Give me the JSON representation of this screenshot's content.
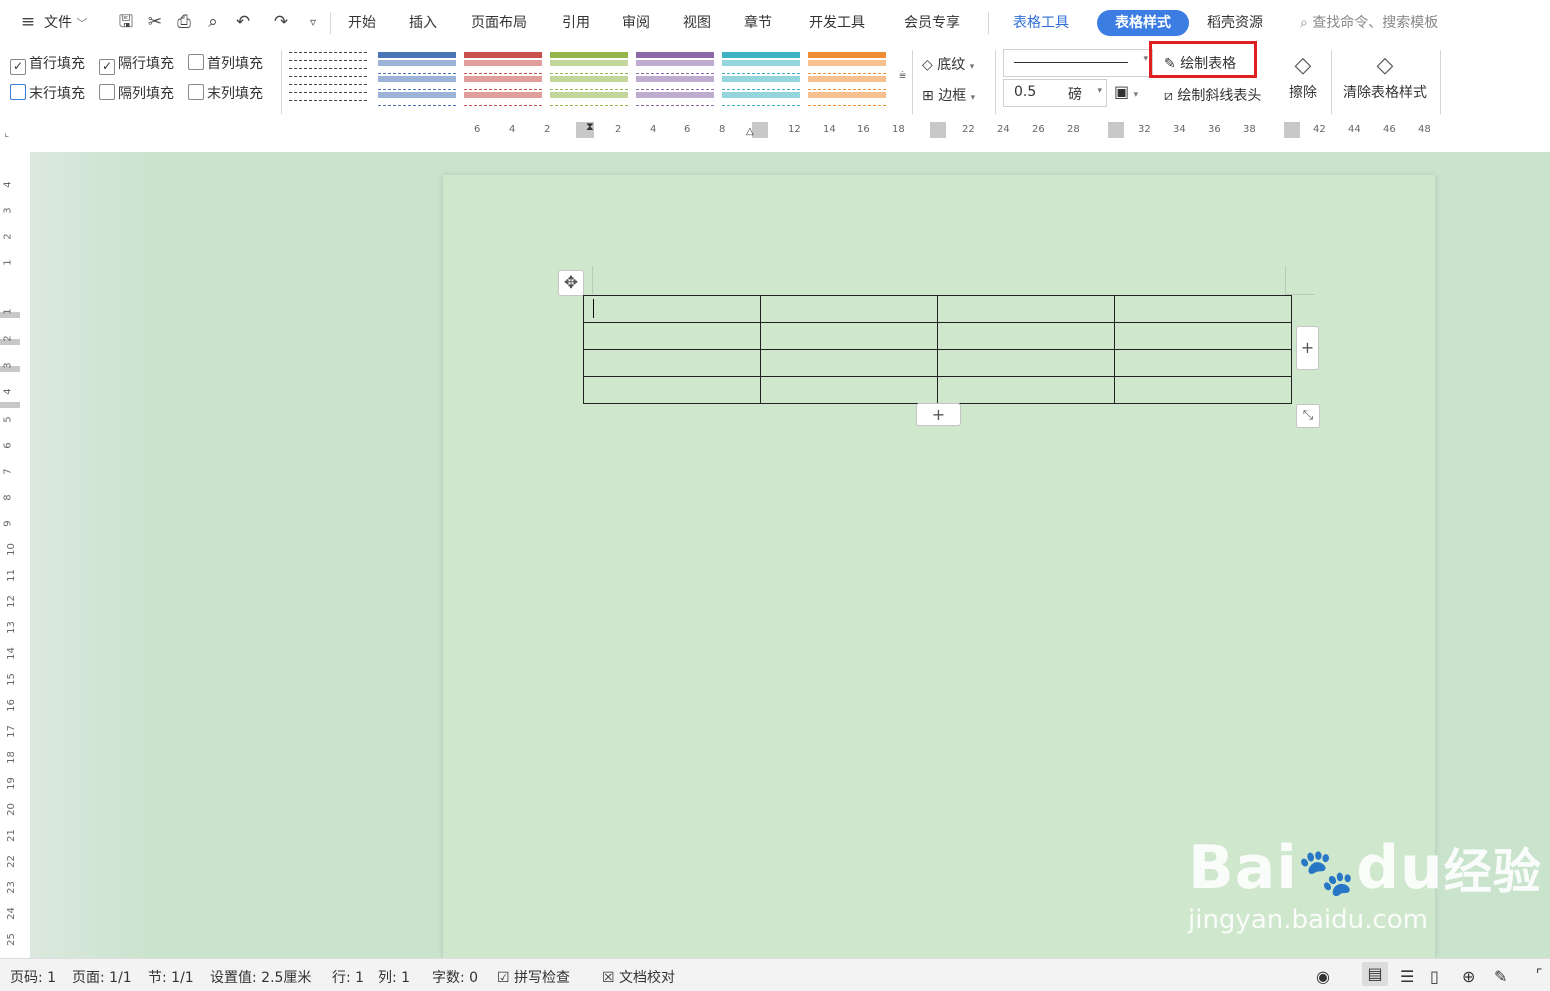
{
  "menubar": {
    "file_label": "文件",
    "tabs": [
      "开始",
      "插入",
      "页面布局",
      "引用",
      "审阅",
      "视图",
      "章节",
      "开发工具",
      "会员专享"
    ],
    "context_tab": "表格工具",
    "active_tab": "表格样式",
    "extra_tab": "稻壳资源",
    "search_placeholder": "查找命令、搜索模板"
  },
  "ribbon": {
    "checkboxes": [
      {
        "label": "首行填充",
        "checked": true
      },
      {
        "label": "隔行填充",
        "checked": true
      },
      {
        "label": "首列填充",
        "checked": false
      },
      {
        "label": "末行填充",
        "checked": false
      },
      {
        "label": "隔列填充",
        "checked": false
      },
      {
        "label": "末列填充",
        "checked": false
      }
    ],
    "style_colors": [
      "#ffffff",
      "#4a76b8",
      "#c9514d",
      "#93b54a",
      "#8c68a8",
      "#3fb3c4",
      "#ef8d35"
    ],
    "shading_label": "底纹",
    "border_label": "边框",
    "line_width_value": "0.5",
    "line_width_unit": "磅",
    "draw_table_label": "绘制表格",
    "draw_diagonal_label": "绘制斜线表头",
    "erase_label": "擦除",
    "clear_style_label": "清除表格样式",
    "highlight_color": "#e02020"
  },
  "ruler": {
    "h_labels": [
      "6",
      "4",
      "2",
      "2",
      "4",
      "6",
      "8",
      "12",
      "14",
      "16",
      "18",
      "22",
      "24",
      "26",
      "28",
      "32",
      "34",
      "36",
      "38",
      "42",
      "44",
      "46",
      "48"
    ],
    "v_labels": [
      "4",
      "3",
      "2",
      "1",
      "1",
      "2",
      "3",
      "4",
      "5",
      "6",
      "7",
      "8",
      "9",
      "10",
      "11",
      "12",
      "13",
      "14",
      "15",
      "16",
      "17",
      "18",
      "19",
      "20",
      "21",
      "22",
      "23",
      "24",
      "25"
    ]
  },
  "statusbar": {
    "page": "页码: 1",
    "pages": "页面: 1/1",
    "section": "节: 1/1",
    "setting": "设置值: 2.5厘米",
    "row": "行: 1",
    "col": "列: 1",
    "words": "字数: 0",
    "spell_check": "拼写检查",
    "doc_proof": "文档校对"
  },
  "watermark": {
    "brand": "Bai",
    "brand_tail": "du",
    "cn": "经验",
    "url": "jingyan.baidu.com"
  }
}
